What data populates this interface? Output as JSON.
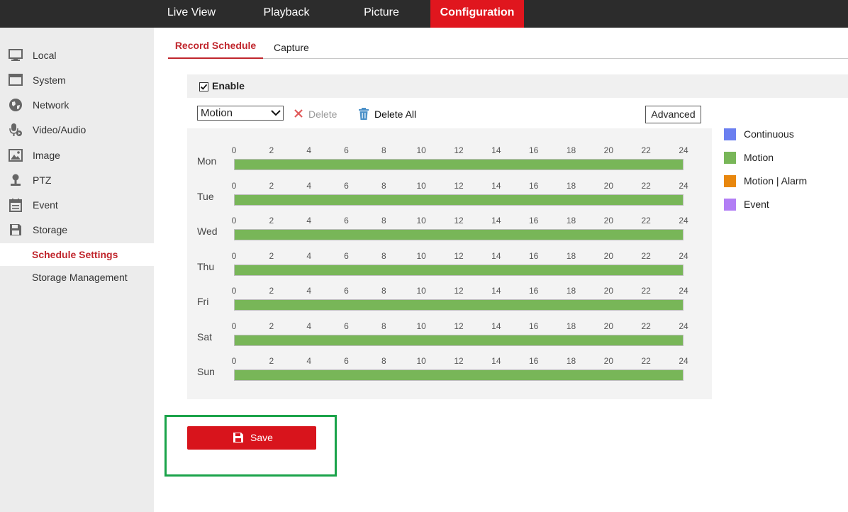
{
  "nav": {
    "tabs": [
      {
        "label": "Live View"
      },
      {
        "label": "Playback"
      },
      {
        "label": "Picture"
      },
      {
        "label": "Configuration",
        "active": true
      }
    ],
    "active_color": "#e0161e"
  },
  "sidebar": {
    "items": [
      {
        "label": "Local",
        "icon": "monitor-icon"
      },
      {
        "label": "System",
        "icon": "system-icon"
      },
      {
        "label": "Network",
        "icon": "globe-icon"
      },
      {
        "label": "Video/Audio",
        "icon": "microphone-icon"
      },
      {
        "label": "Image",
        "icon": "image-icon"
      },
      {
        "label": "PTZ",
        "icon": "ptz-icon"
      },
      {
        "label": "Event",
        "icon": "calendar-icon"
      },
      {
        "label": "Storage",
        "icon": "floppy-icon"
      }
    ],
    "sub_items": [
      {
        "label": "Schedule Settings",
        "active": true
      },
      {
        "label": "Storage Management"
      }
    ]
  },
  "tabs": [
    {
      "label": "Record Schedule",
      "active": true
    },
    {
      "label": "Capture"
    }
  ],
  "enable": {
    "label": "Enable",
    "checked": true
  },
  "toolbar": {
    "type_select": {
      "value": "Motion"
    },
    "delete_label": "Delete",
    "delete_all_label": "Delete All",
    "advanced_label": "Advanced"
  },
  "schedule": {
    "hour_ticks": [
      "0",
      "2",
      "4",
      "6",
      "8",
      "10",
      "12",
      "14",
      "16",
      "18",
      "20",
      "22",
      "24"
    ],
    "days": [
      {
        "label": "Mon",
        "segments": [
          {
            "start": 0,
            "end": 24,
            "type": "Motion"
          }
        ]
      },
      {
        "label": "Tue",
        "segments": [
          {
            "start": 0,
            "end": 24,
            "type": "Motion"
          }
        ]
      },
      {
        "label": "Wed",
        "segments": [
          {
            "start": 0,
            "end": 24,
            "type": "Motion"
          }
        ]
      },
      {
        "label": "Thu",
        "segments": [
          {
            "start": 0,
            "end": 24,
            "type": "Motion"
          }
        ]
      },
      {
        "label": "Fri",
        "segments": [
          {
            "start": 0,
            "end": 24,
            "type": "Motion"
          }
        ]
      },
      {
        "label": "Sat",
        "segments": [
          {
            "start": 0,
            "end": 24,
            "type": "Motion"
          }
        ]
      },
      {
        "label": "Sun",
        "segments": [
          {
            "start": 0,
            "end": 24,
            "type": "Motion"
          }
        ]
      }
    ]
  },
  "legend": [
    {
      "label": "Continuous",
      "color": "#6b7ff0"
    },
    {
      "label": "Motion",
      "color": "#78b658"
    },
    {
      "label": "Motion | Alarm",
      "color": "#e8870e"
    },
    {
      "label": "Event",
      "color": "#b27ef5"
    }
  ],
  "save": {
    "label": "Save",
    "color": "#d8141c"
  }
}
